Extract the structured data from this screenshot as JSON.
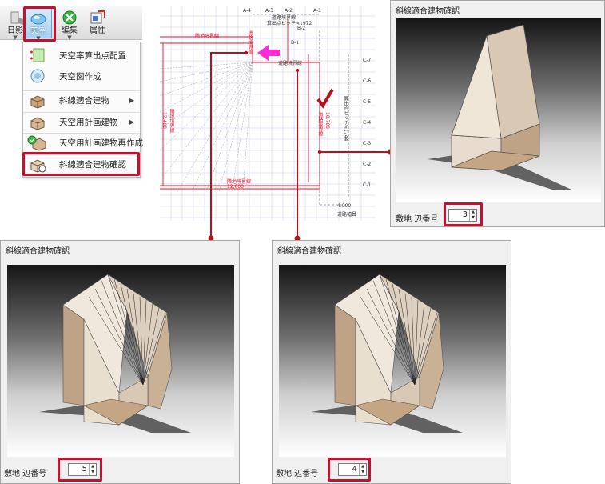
{
  "toolbar": {
    "shadow_label": "日影",
    "sky_label": "天空",
    "edit_label": "編集",
    "attr_label": "属性"
  },
  "menu": {
    "items": [
      {
        "label": "天空率算出点配置",
        "icon": "sky-point-icon"
      },
      {
        "label": "天空図作成",
        "icon": "sky-diagram-icon"
      },
      {
        "label": "斜線適合建物",
        "icon": "box-building-icon",
        "submenu": true
      },
      {
        "label": "天空用計画建物",
        "icon": "box-building-icon",
        "submenu": true
      },
      {
        "label": "天空用計画建物再作成",
        "icon": "rebuild-icon"
      },
      {
        "label": "斜線適合建物確認",
        "icon": "building-check-icon",
        "highlighted": true
      }
    ]
  },
  "plan": {
    "labels": {
      "a4": "A-4",
      "a3": "A-3",
      "a2": "A-2",
      "a1": "A-1",
      "road_boundary_top": "道路境界線",
      "calc_pitch_top": "算出点ピッチ≒1972",
      "b2": "B-2",
      "b1": "B-1",
      "adjacent_boundary": "隣地境界線",
      "road_boundary_line_v": "道路境界線",
      "road_boundary_mid": "道路境界線",
      "c7": "C-7",
      "c6": "C-6",
      "c5": "C-5",
      "c4": "C-4",
      "c3": "C-3",
      "c2": "C-2",
      "c1": "C-1",
      "left_dim": "12.400",
      "left_boundary": "隣地境界線",
      "right_road_boundary": "道路境界線",
      "right_road_dim": "10.788",
      "calc_pitch_right": "算出点ピッチ≒1744",
      "bottom_boundary": "隣地境界線",
      "bottom_dim": "12.000",
      "road_width_dim": "4.000",
      "road_width_label": "道路幅員"
    }
  },
  "dialogs": {
    "edge3": {
      "title": "斜線適合建物確認",
      "edge_label": "敷地 辺番号",
      "edge_value": "3"
    },
    "edge5": {
      "title": "斜線適合建物確認",
      "edge_label": "敷地 辺番号",
      "edge_value": "5"
    },
    "edge4": {
      "title": "斜線適合建物確認",
      "edge_label": "敷地 辺番号",
      "edge_value": "4"
    }
  },
  "colors": {
    "highlight": "#c8102e",
    "leader": "#b5121b",
    "plan_red": "#e8102a",
    "arrow_magenta": "#ff2bd6",
    "building_front": "#efe6d8",
    "building_side": "#c9b195"
  }
}
